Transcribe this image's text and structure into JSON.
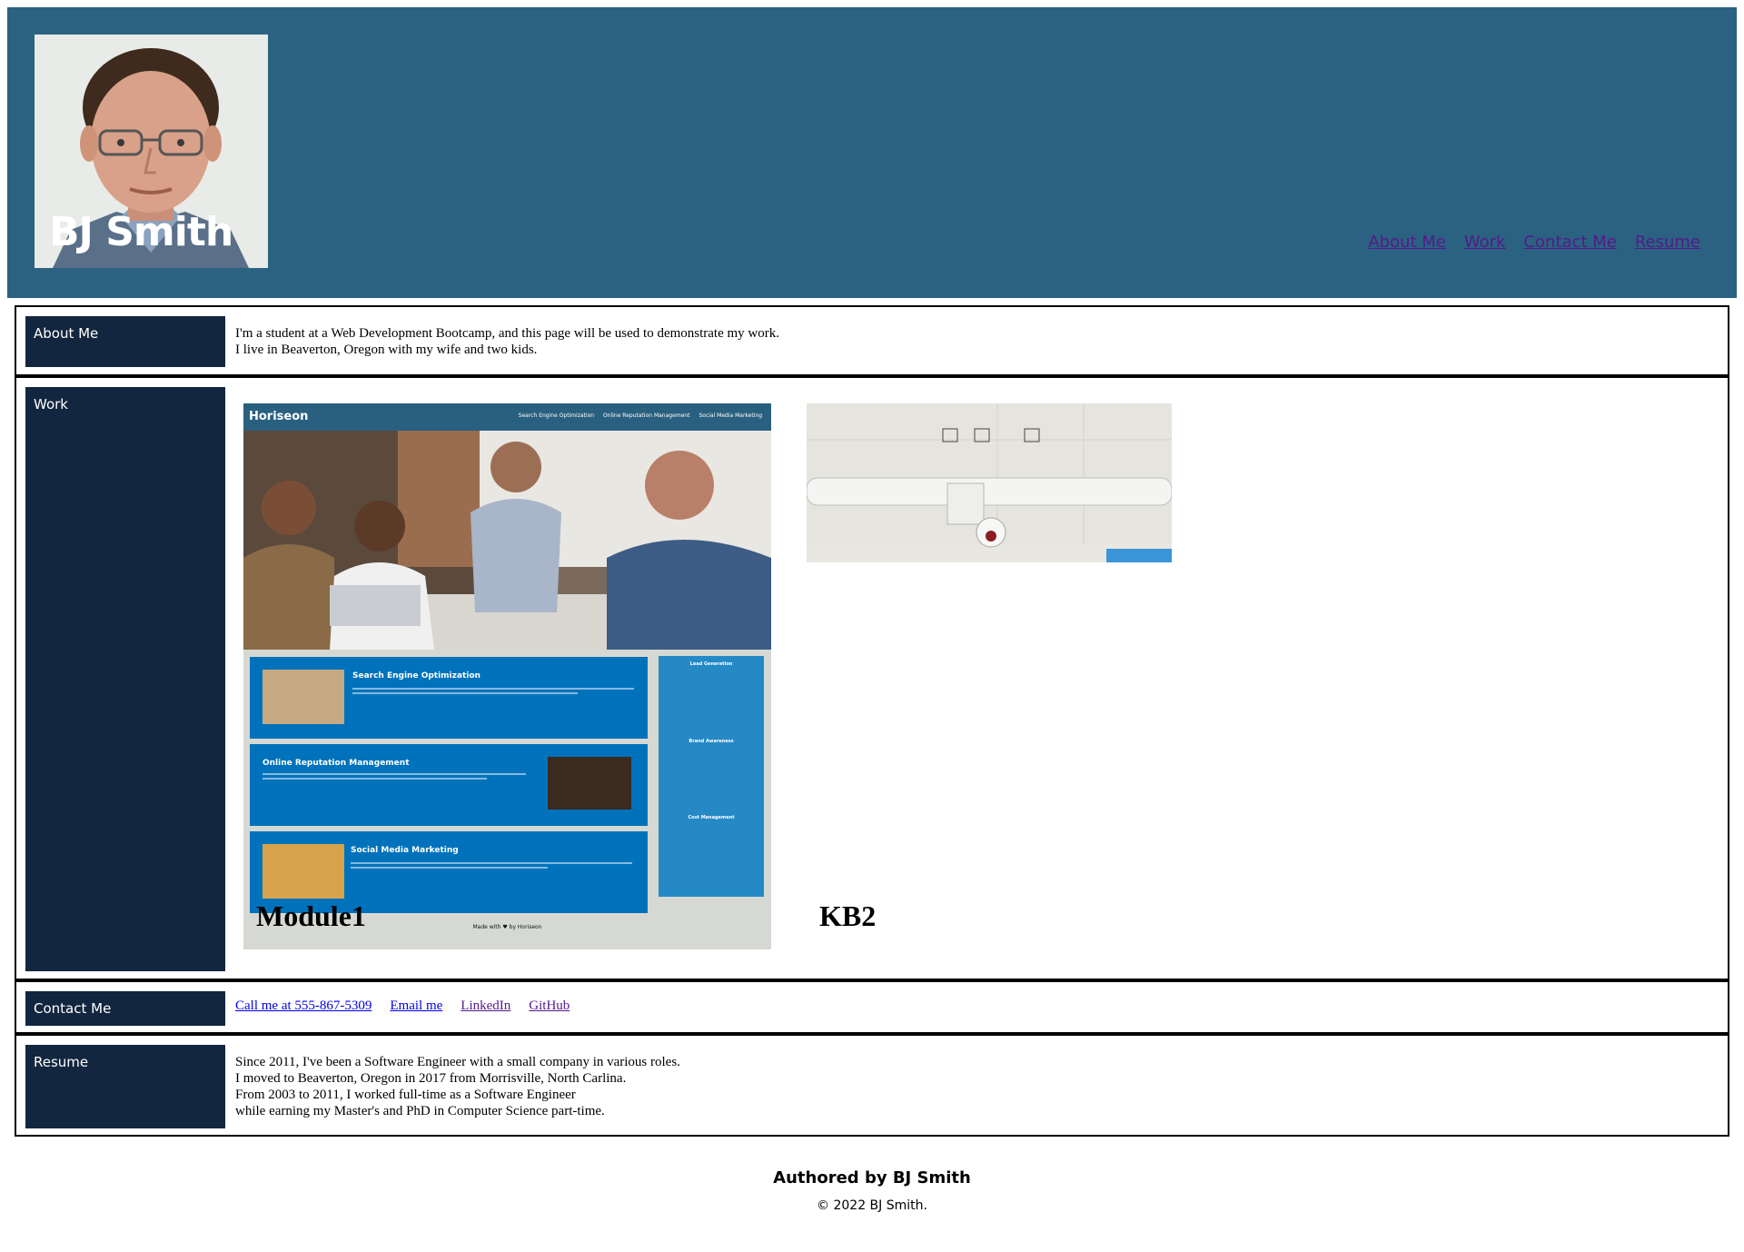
{
  "header": {
    "name": "BJ Smith",
    "avatar_alt": "BJ Smith",
    "nav": [
      "About Me",
      "Work",
      "Contact Me",
      "Resume"
    ]
  },
  "about": {
    "label": "About Me",
    "lines": [
      "I'm a student at a Web Development Bootcamp, and this page will be used to demonstrate my work.",
      "I live in Beaverton, Oregon with my wife and two kids."
    ]
  },
  "work": {
    "label": "Work",
    "projects": [
      {
        "caption": "Module1",
        "preview": {
          "brand": "Horiseon",
          "nav": [
            "Search Engine Optimization",
            "Online Reputation Management",
            "Social Media Marketing"
          ],
          "panels": [
            "Search Engine Optimization",
            "Online Reputation Management",
            "Social Media Marketing"
          ],
          "side": [
            "Lead Generation",
            "Brand Awareness",
            "Cost Management"
          ],
          "footer": "Made with ♥ by Horiseon"
        }
      },
      {
        "caption": "KB2"
      }
    ]
  },
  "contact": {
    "label": "Contact Me",
    "links": [
      "Call me at 555-867-5309",
      "Email me",
      "LinkedIn",
      "GitHub"
    ]
  },
  "resume": {
    "label": "Resume",
    "lines": [
      "Since 2011, I've been a Software Engineer with a small company in various roles.",
      "I moved to Beaverton, Oregon in 2017 from Morrisville, North Carlina.",
      "From 2003 to 2011, I worked full-time as a Software Engineer",
      "while earning my Master's and PhD in Computer Science part-time."
    ]
  },
  "footer": {
    "author": "Authored by BJ Smith",
    "copyright": "© 2022 BJ Smith."
  }
}
